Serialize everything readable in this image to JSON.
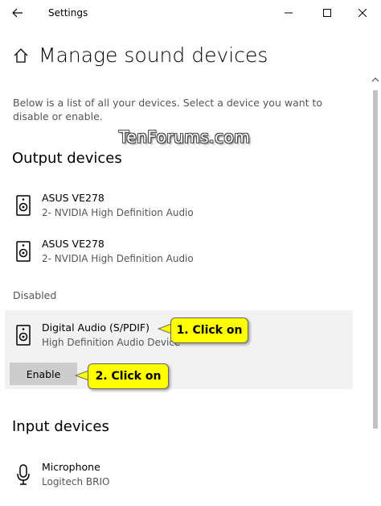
{
  "window": {
    "title": "Settings",
    "back_icon": "back-arrow-icon"
  },
  "page": {
    "title": "Manage sound devices",
    "description": "Below is a list of all your devices. Select a device you want to disable or enable.",
    "watermark": "TenForums.com"
  },
  "output": {
    "heading": "Output devices",
    "devices": [
      {
        "name": "ASUS VE278",
        "sub": "2- NVIDIA High Definition Audio",
        "icon": "speaker-icon"
      },
      {
        "name": "ASUS VE278",
        "sub": "2- NVIDIA High Definition Audio",
        "icon": "speaker-icon"
      }
    ]
  },
  "disabled": {
    "label": "Disabled",
    "device": {
      "name": "Digital Audio (S/PDIF)",
      "sub": "High Definition Audio Device",
      "icon": "speaker-icon"
    },
    "enable_label": "Enable"
  },
  "callouts": {
    "first": "1. Click on",
    "second": "2. Click on",
    "color": "#ffff00"
  },
  "input": {
    "heading": "Input devices",
    "devices": [
      {
        "name": "Microphone",
        "sub": "Logitech BRIO",
        "icon": "microphone-icon"
      }
    ]
  }
}
